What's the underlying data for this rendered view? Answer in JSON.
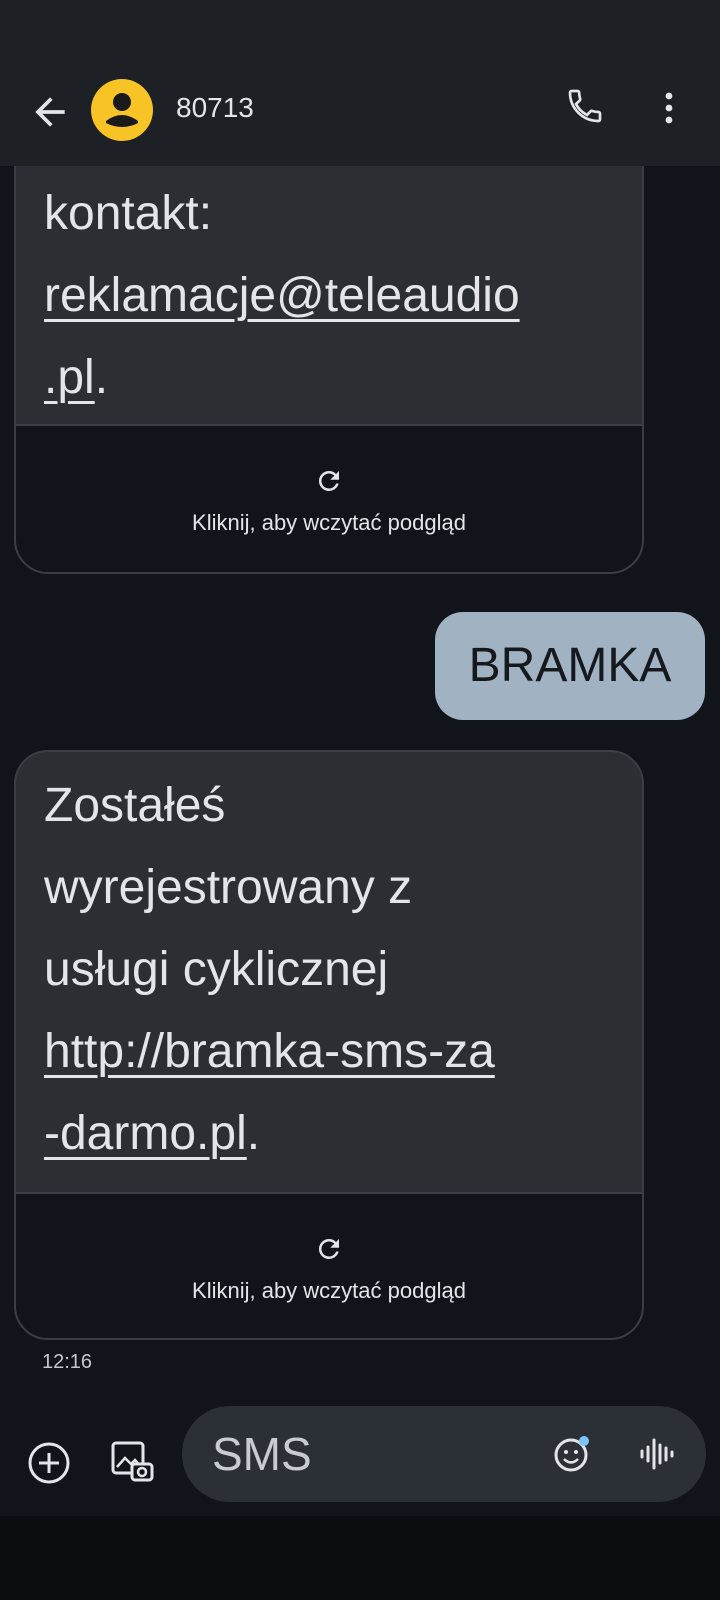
{
  "header": {
    "contact_name": "80713",
    "icons": {
      "back": "arrow-left-icon",
      "avatar": "person-icon",
      "call": "phone-icon",
      "more": "more-vert-icon"
    },
    "colors": {
      "avatar_bg": "#f7c325",
      "bar_bg": "#1d2024"
    }
  },
  "messages": [
    {
      "direction": "incoming",
      "text_lines": [
        "kontakt:"
      ],
      "link_lines": [
        "reklamacje@teleaudio",
        ".pl"
      ],
      "trailing": ".",
      "preview_label": "Kliknij, aby wczytać podgląd"
    },
    {
      "direction": "outgoing",
      "text": "BRAMKA"
    },
    {
      "direction": "incoming",
      "text_lines": [
        "Zostałeś",
        "wyrejestrowany z",
        "usługi cyklicznej"
      ],
      "link_lines": [
        "http://bramka-sms-za",
        "-darmo.pl"
      ],
      "trailing": ".",
      "preview_label": "Kliknij, aby wczytać podgląd"
    }
  ],
  "timestamp": "12:16",
  "composer": {
    "placeholder": "SMS",
    "icons": {
      "add": "add-circle-icon",
      "gallery": "gallery-icon",
      "emoji": "emoji-icon",
      "voice": "voice-wave-icon"
    }
  },
  "colors": {
    "background": "#11151b",
    "incoming_bubble": "#2b2f34",
    "outgoing_bubble": "#a1b2c2"
  }
}
